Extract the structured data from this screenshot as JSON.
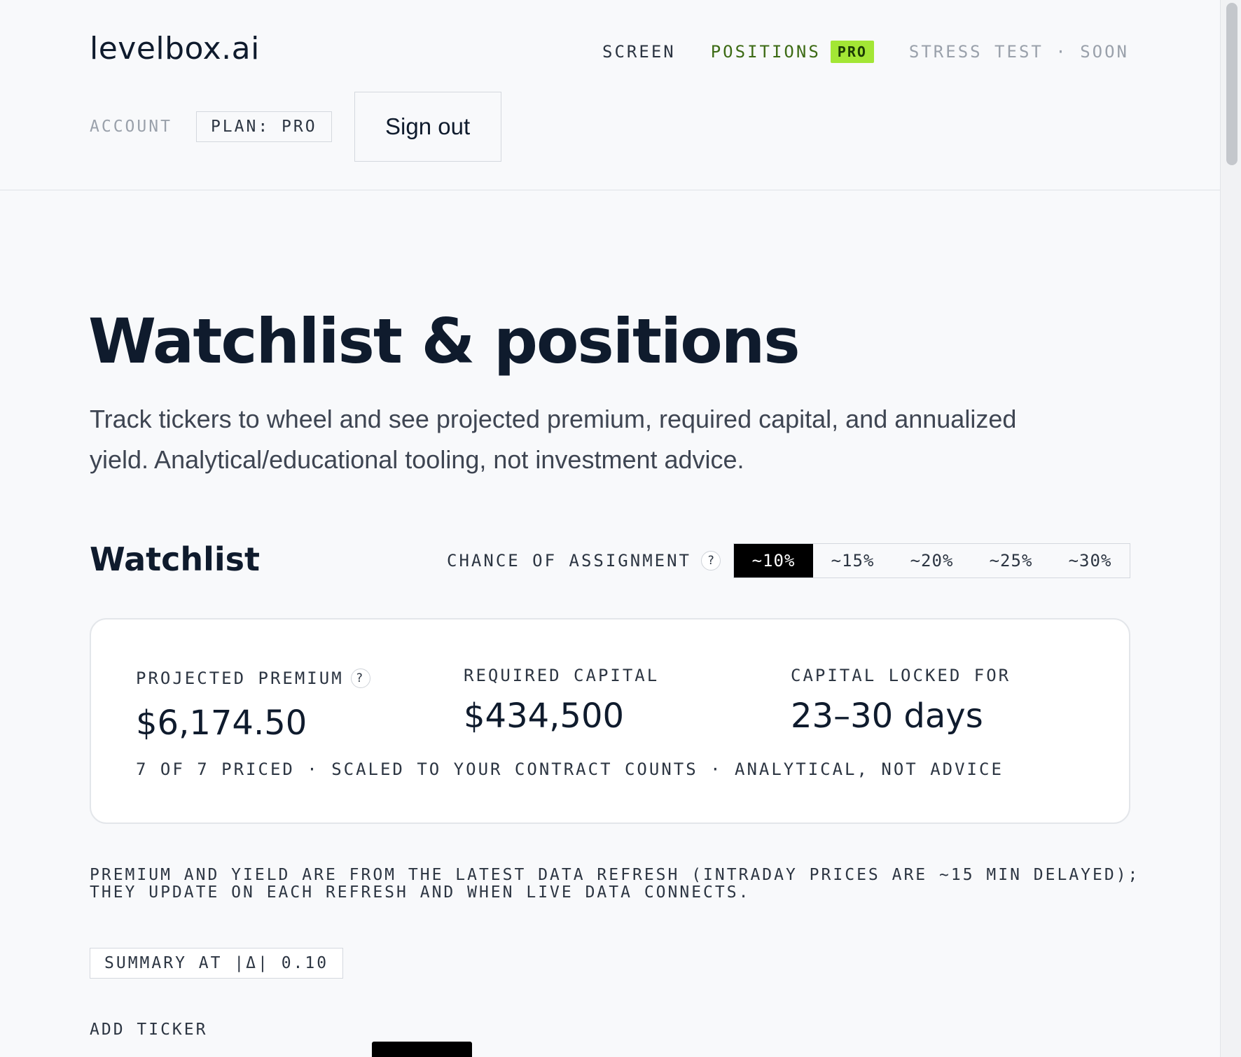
{
  "header": {
    "logo": "levelbox.ai",
    "nav": {
      "screen": "SCREEN",
      "positions": "POSITIONS",
      "positions_badge": "PRO",
      "stress_test": "STRESS TEST · SOON"
    },
    "account_label": "ACCOUNT",
    "plan": "PLAN: PRO",
    "sign_out": "Sign out"
  },
  "hero": {
    "title": "Watchlist & positions",
    "description": "Track tickers to wheel and see projected premium, required capital, and annualized yield. Analytical/educational tooling, not investment advice."
  },
  "watchlist": {
    "title": "Watchlist",
    "assignment_label": "CHANCE OF ASSIGNMENT",
    "help": "?",
    "options": [
      "~10%",
      "~15%",
      "~20%",
      "~25%",
      "~30%"
    ],
    "selected_option": "~10%",
    "summary": {
      "projected_premium_label": "PROJECTED PREMIUM",
      "projected_premium_value": "$6,174.50",
      "required_capital_label": "REQUIRED CAPITAL",
      "required_capital_value": "$434,500",
      "capital_locked_label": "CAPITAL LOCKED FOR",
      "capital_locked_value": "23–30 days",
      "footnote": "7 OF 7 PRICED · SCALED TO YOUR CONTRACT COUNTS · ANALYTICAL, NOT ADVICE"
    },
    "disclaimer": "PREMIUM AND YIELD ARE FROM THE LATEST DATA REFRESH (INTRADAY PRICES ARE ~15 MIN DELAYED); THEY UPDATE ON EACH REFRESH AND WHEN LIVE DATA CONNECTS.",
    "summary_tag": "SUMMARY AT |Δ| 0.10",
    "add_ticker_label": "ADD TICKER"
  },
  "colors": {
    "accent_green": "#a3e635",
    "active_nav": "#3d6b15",
    "selected_segment": "#000000"
  }
}
